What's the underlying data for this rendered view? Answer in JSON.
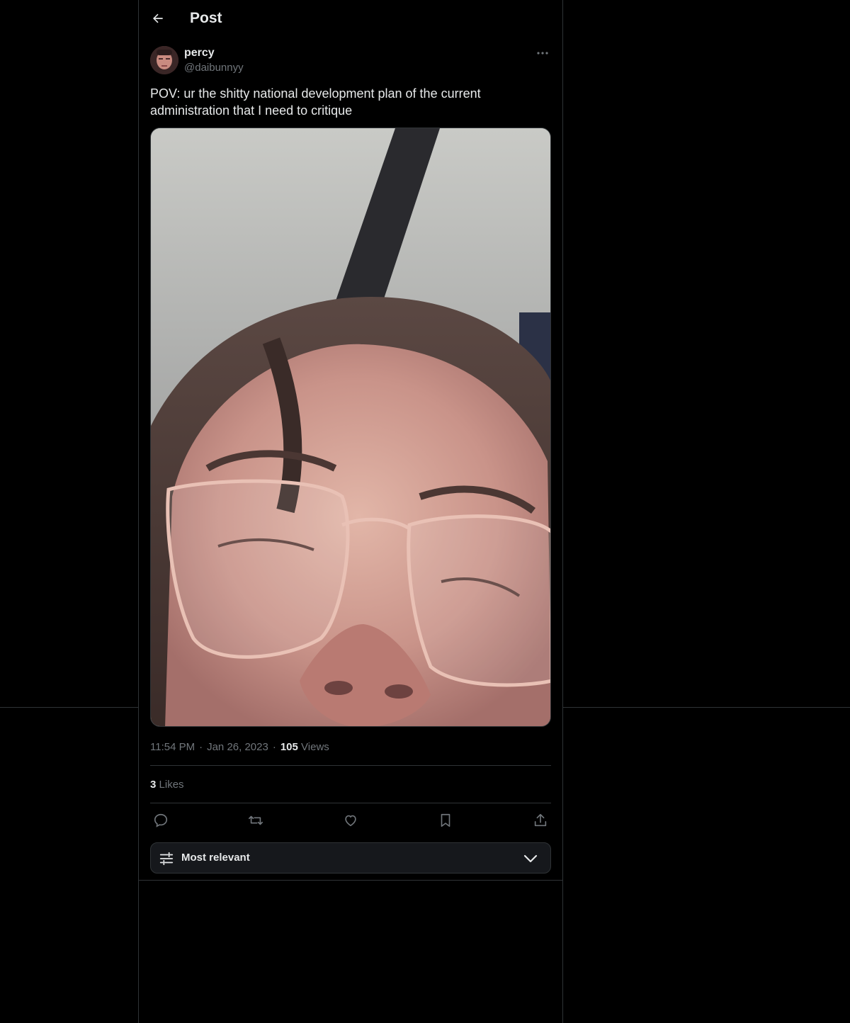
{
  "header": {
    "title": "Post",
    "back_icon": "arrow-left-icon"
  },
  "post": {
    "author": {
      "name": "percy",
      "handle": "@daibunnyy"
    },
    "text": "POV: ur the shitty national development plan of the current administration that I need to critique",
    "media_alt": "selfie photo",
    "time": "11:54 PM",
    "separator": "·",
    "date": "Jan 26, 2023",
    "views_count": "105",
    "views_label": "Views",
    "likes_count": "3",
    "likes_label": "Likes",
    "actions": [
      "reply-icon",
      "repost-icon",
      "like-icon",
      "bookmark-icon",
      "share-icon"
    ]
  },
  "replies": {
    "sort_label": "Most relevant",
    "sort_icon": "sliders-icon",
    "chevron_icon": "chevron-down-icon"
  },
  "colors": {
    "background": "#000000",
    "text_primary": "#e7e9ea",
    "text_secondary": "#71767b",
    "border": "#2f3336",
    "sort_bg": "#16181c"
  }
}
